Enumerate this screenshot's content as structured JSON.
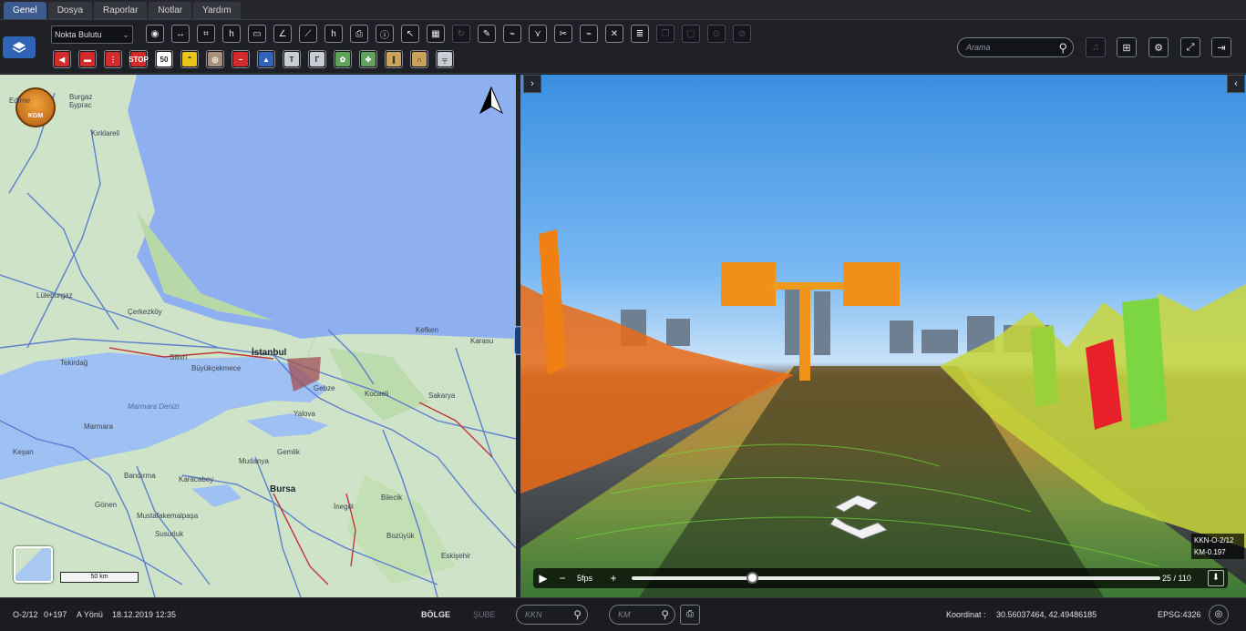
{
  "menu": {
    "tabs": [
      {
        "label": "Genel",
        "active": true
      },
      {
        "label": "Dosya",
        "active": false
      },
      {
        "label": "Raporlar",
        "active": false
      },
      {
        "label": "Notlar",
        "active": false
      },
      {
        "label": "Yardım",
        "active": false
      }
    ]
  },
  "toolbar": {
    "layer_select": "Nokta Bulutu",
    "row1_icons": [
      "hide-icon",
      "distance-icon",
      "profile-icon",
      "height-icon",
      "area-icon",
      "angle-icon",
      "slope-icon",
      "clearance-icon",
      "print-icon",
      "info-icon",
      "pointer-icon",
      "grid-icon",
      "rotate-icon",
      "edit-icon",
      "line-chart-icon",
      "split-icon",
      "marker-icon",
      "trend-icon",
      "delete-icon",
      "list-icon",
      "copy-icon",
      "paste-icon",
      "link-icon",
      "clear-icon"
    ],
    "row1_glyphs": [
      "◉",
      "↔",
      "⌗",
      "h",
      "▭",
      "∠",
      "⟋",
      "h",
      "⎙",
      "ⓘ",
      "↖",
      "▦",
      "↻",
      "✎",
      "⌁",
      "⋎",
      "✂",
      "⌁",
      "✕",
      "≣",
      "❐",
      "▢",
      "⊙",
      "⊘"
    ],
    "row1_disabled": [
      false,
      false,
      false,
      false,
      false,
      false,
      false,
      false,
      false,
      false,
      false,
      false,
      true,
      false,
      false,
      false,
      false,
      false,
      false,
      false,
      true,
      true,
      true,
      true
    ],
    "row2_icons": [
      {
        "name": "warning-sign-icon",
        "glyph": "◀",
        "bg": "#d32b2b"
      },
      {
        "name": "barrier-sign-icon",
        "glyph": "▬",
        "bg": "#d32b2b"
      },
      {
        "name": "danger-sign-icon",
        "glyph": "⋮",
        "bg": "#d32b2b"
      },
      {
        "name": "stop-sign-icon",
        "glyph": "STOP",
        "bg": "#d32b2b"
      },
      {
        "name": "speed-limit-icon",
        "glyph": "50",
        "bg": "#ffffff"
      },
      {
        "name": "chevron-sign-icon",
        "glyph": "⌃",
        "bg": "#e8c51a"
      },
      {
        "name": "roundabout-sign-icon",
        "glyph": "◎",
        "bg": "#a8907a"
      },
      {
        "name": "no-entry-icon",
        "glyph": "−",
        "bg": "#d32b2b"
      },
      {
        "name": "info-sign-icon",
        "glyph": "▲",
        "bg": "#2f64b8"
      },
      {
        "name": "pole-icon",
        "glyph": "T",
        "bg": "#c9ccd2"
      },
      {
        "name": "lamp-pole-icon",
        "glyph": "Γ",
        "bg": "#c9ccd2"
      },
      {
        "name": "tree-icon",
        "glyph": "✿",
        "bg": "#5fa35a"
      },
      {
        "name": "bush-icon",
        "glyph": "✤",
        "bg": "#5fa35a"
      },
      {
        "name": "road-icon",
        "glyph": "∥",
        "bg": "#c9a45a"
      },
      {
        "name": "tunnel-icon",
        "glyph": "∩",
        "bg": "#c9a45a"
      },
      {
        "name": "gantry-icon",
        "glyph": "╤",
        "bg": "#c9ccd2"
      }
    ],
    "search_placeholder": "Arama"
  },
  "map": {
    "logo_text": "KGM",
    "places": [
      {
        "label": "Burgaz\nБургас",
        "kind": "town"
      },
      {
        "label": "Kırklareli",
        "kind": "town"
      },
      {
        "label": "Edirne",
        "kind": "town"
      },
      {
        "label": "Lüleburgaz",
        "kind": "town"
      },
      {
        "label": "Çerkezköy",
        "kind": "town"
      },
      {
        "label": "İstanbul",
        "kind": "big"
      },
      {
        "label": "Silivri",
        "kind": "town"
      },
      {
        "label": "Büyükçekmece",
        "kind": "town"
      },
      {
        "label": "Tekirdağ",
        "kind": "town"
      },
      {
        "label": "Marmara Denizi",
        "kind": "sea"
      },
      {
        "label": "Marmara",
        "kind": "town"
      },
      {
        "label": "Gebze",
        "kind": "town"
      },
      {
        "label": "Kocaeli",
        "kind": "town"
      },
      {
        "label": "Sakarya",
        "kind": "town"
      },
      {
        "label": "Yalova",
        "kind": "town"
      },
      {
        "label": "Gemlik",
        "kind": "town"
      },
      {
        "label": "Mudanya",
        "kind": "town"
      },
      {
        "label": "Bursa",
        "kind": "big"
      },
      {
        "label": "Bandırma",
        "kind": "town"
      },
      {
        "label": "Karacabey",
        "kind": "town"
      },
      {
        "label": "Gönen",
        "kind": "town"
      },
      {
        "label": "Mustafakemalpaşa",
        "kind": "town"
      },
      {
        "label": "İnegöl",
        "kind": "town"
      },
      {
        "label": "Bilecik",
        "kind": "town"
      },
      {
        "label": "Bozüyük",
        "kind": "town"
      },
      {
        "label": "Eskişehir",
        "kind": "town"
      },
      {
        "label": "Karasu",
        "kind": "town"
      },
      {
        "label": "Kefken",
        "kind": "town"
      },
      {
        "label": "Susurluk",
        "kind": "town"
      },
      {
        "label": "Keşan",
        "kind": "town"
      }
    ],
    "scale": "50 km"
  },
  "viewer": {
    "left_toggle": "›",
    "right_toggle": "‹",
    "overlay_line1": "KKN-O-2/12",
    "overlay_line2": "KM-0.197",
    "fps": "5fps",
    "frame_current": 25,
    "frame_total": 110,
    "frame_text": "25 / 110"
  },
  "status": {
    "route": "O-2/12",
    "km": "0+197",
    "direction": "A Yönü",
    "datetime": "18.12.2019 12:35",
    "region_label": "BÖLGE",
    "branch_label": "ŞUBE",
    "kkn_placeholder": "KKN",
    "km_placeholder": "KM",
    "coord_label": "Koordinat :",
    "coords": "30.56037464, 42.49486185",
    "epsg": "EPSG:4326"
  },
  "colors": {
    "accent": "#2f64b8",
    "active_tab": "#3d5a8c",
    "sea": "#8fb0f0",
    "land": "#cfe3c8"
  }
}
